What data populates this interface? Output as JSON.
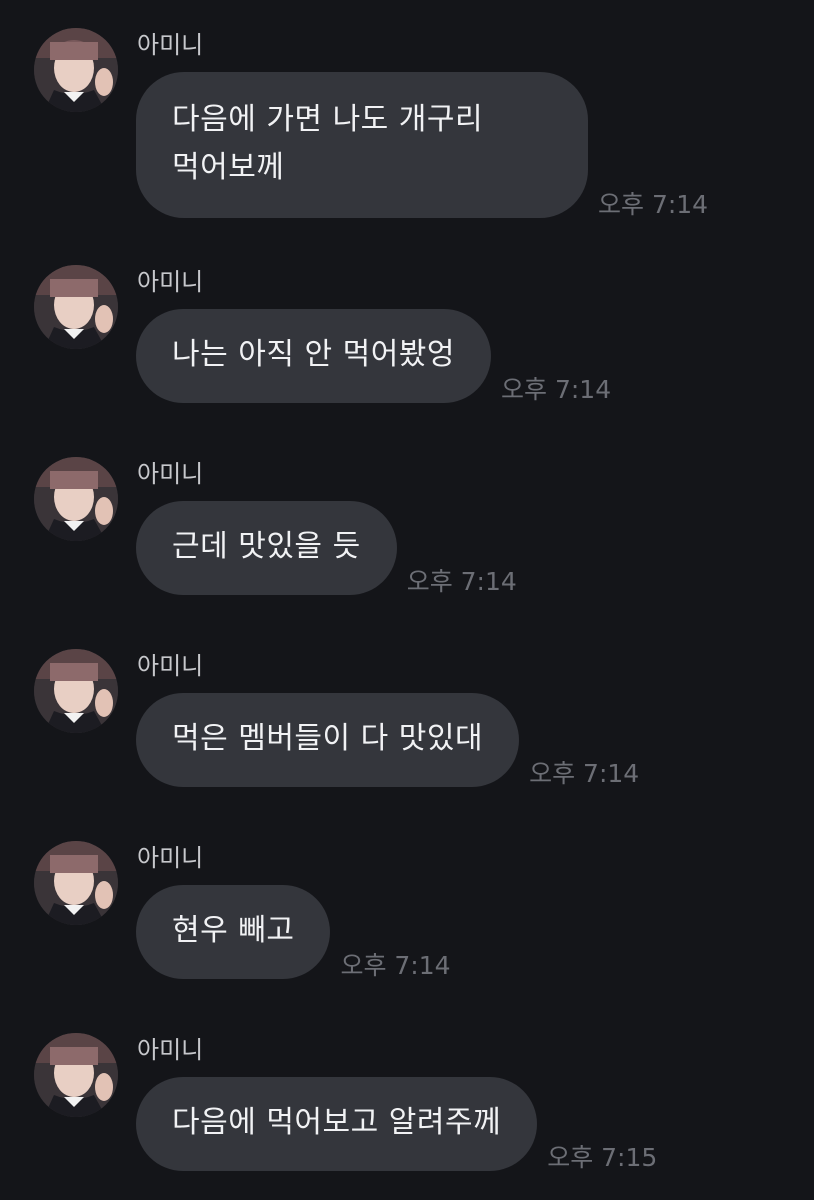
{
  "chat": {
    "messages": [
      {
        "sender": "아미니",
        "text": "다음에 가면 나도 개구리\n먹어보께",
        "time": "오후 7:14"
      },
      {
        "sender": "아미니",
        "text": "나는 아직 안 먹어봤엉",
        "time": "오후 7:14"
      },
      {
        "sender": "아미니",
        "text": "근데 맛있을 듯",
        "time": "오후 7:14"
      },
      {
        "sender": "아미니",
        "text": "먹은 멤버들이 다 맛있대",
        "time": "오후 7:14"
      },
      {
        "sender": "아미니",
        "text": "현우 빼고",
        "time": "오후 7:14"
      },
      {
        "sender": "아미니",
        "text": "다음에 먹어보고 알려주께",
        "time": "오후 7:15"
      }
    ]
  },
  "colors": {
    "background": "#141519",
    "bubble": "#34363c",
    "bubble_text": "#f1f2f4",
    "sender_text": "#c7c8cc",
    "time_text": "#6c6e75"
  }
}
